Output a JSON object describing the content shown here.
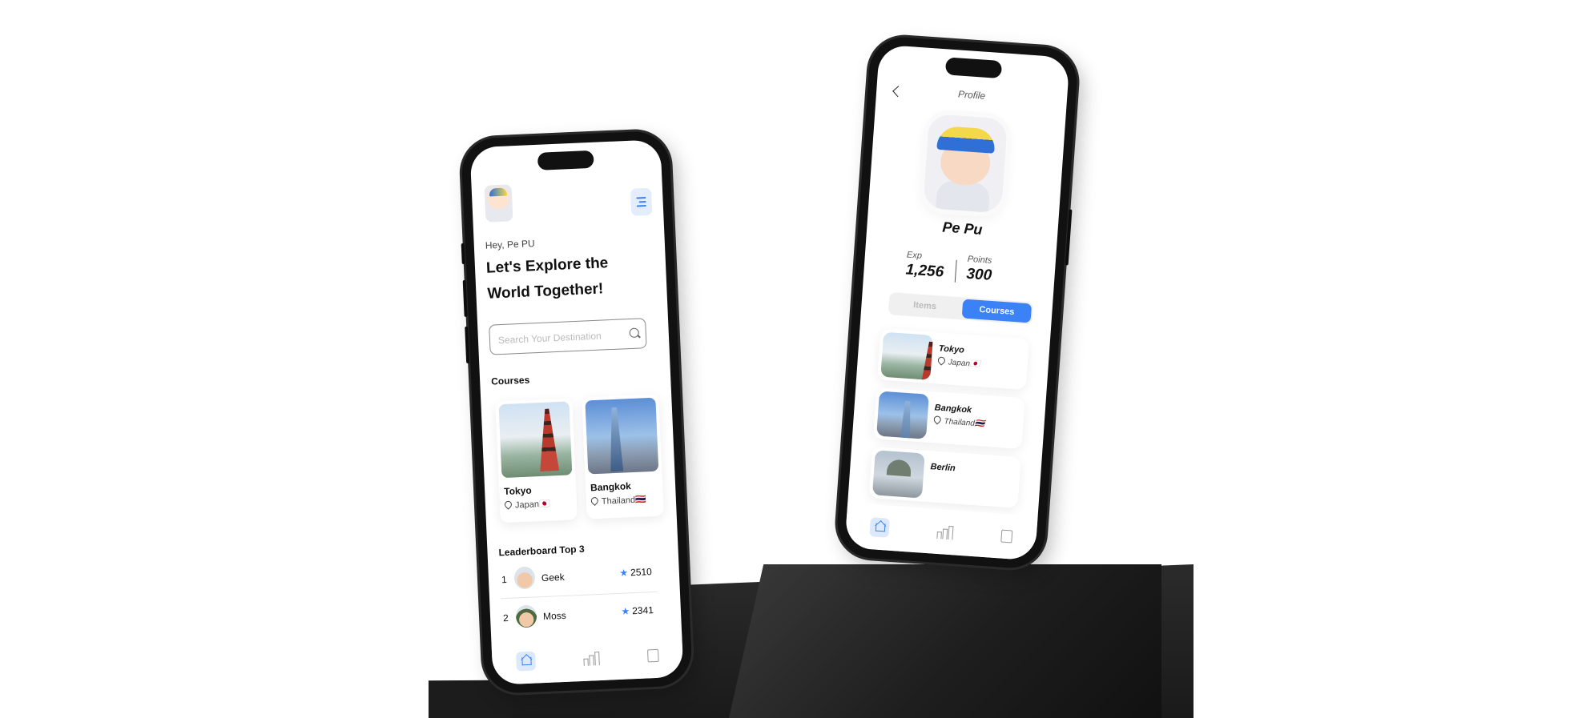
{
  "home": {
    "greeting": "Hey, Pe PU",
    "headline": "Let's Explore the World Together!",
    "search": {
      "placeholder": "Search Your Destination",
      "value": ""
    },
    "courses_title": "Courses",
    "courses": [
      {
        "name": "Tokyo",
        "location": "Japan🇯🇵"
      },
      {
        "name": "Bangkok",
        "location": "Thailand🇹🇭"
      }
    ],
    "leaderboard_title": "Leaderboard Top 3",
    "leaderboard": [
      {
        "rank": "1",
        "name": "Geek",
        "score": "2510"
      },
      {
        "rank": "2",
        "name": "Moss",
        "score": "2341"
      }
    ],
    "nav": [
      "home-icon",
      "chart-icon",
      "bag-icon"
    ]
  },
  "profile": {
    "title": "Profile",
    "name": "Pe Pu",
    "exp_label": "Exp",
    "exp_value": "1,256",
    "points_label": "Points",
    "points_value": "300",
    "tabs": {
      "items": "Items",
      "courses": "Courses",
      "active": "Courses"
    },
    "courses": [
      {
        "name": "Tokyo",
        "location": "Japan🇯🇵"
      },
      {
        "name": "Bangkok",
        "location": "Thailand🇹🇭"
      },
      {
        "name": "Berlin",
        "location": ""
      }
    ]
  },
  "colors": {
    "accent": "#3b82f6",
    "pedestal": "#262626"
  }
}
